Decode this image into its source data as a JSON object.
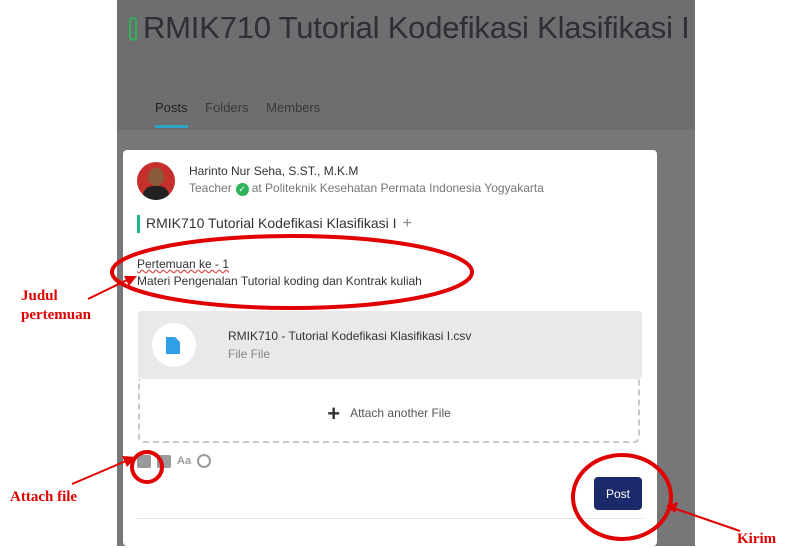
{
  "course": {
    "title": "RMIK710 Tutorial Kodefikasi Klasifikasi I"
  },
  "tabs": [
    "Posts",
    "Folders",
    "Members"
  ],
  "post": {
    "author": "Harinto Nur Seha, S.ST., M.K.M",
    "role": "Teacher",
    "institution": "at Politeknik Kesehatan Permata Indonesia Yogyakarta",
    "course_ref": "RMIK710 Tutorial Kodefikasi Klasifikasi I",
    "line1": "Pertemuan ke - 1",
    "line2": "Materi Pengenalan Tutorial koding dan Kontrak kuliah",
    "file_name": "RMIK710 - Tutorial Kodefikasi Klasifikasi I.csv",
    "file_type": "File File",
    "attach_label": "Attach another File",
    "format_label": "Aa",
    "post_label": "Post"
  },
  "annotations": {
    "judul": "Judul",
    "pertemuan": "pertemuan",
    "attach": "Attach file",
    "kirim": "Kirim"
  },
  "colors": {
    "annotation": "#e10000",
    "post_button": "#1c2a6b",
    "accent": "#2fb35a"
  },
  "icons": [
    "course-icon",
    "verified-icon",
    "plus-icon",
    "file-icon",
    "image-icon",
    "camera-icon",
    "text-format-icon",
    "clock-icon"
  ]
}
